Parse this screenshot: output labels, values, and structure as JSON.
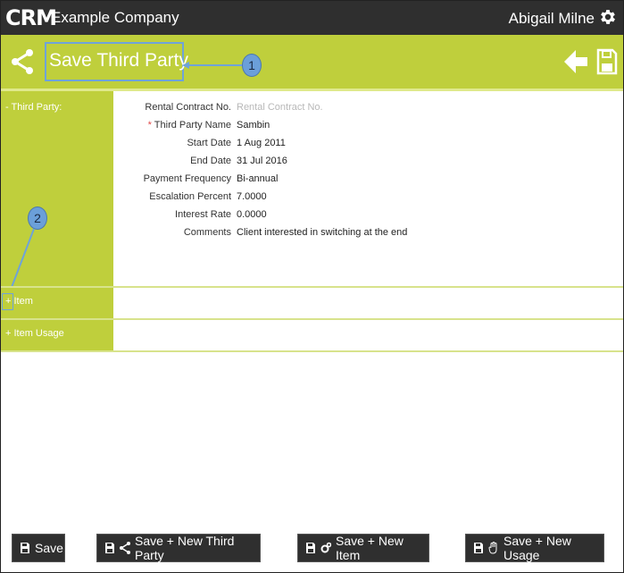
{
  "header": {
    "logo_text": "CRM",
    "company": "Example Company",
    "user": "Abigail Milne",
    "settings_icon": "gear-icon"
  },
  "titlebar": {
    "title": "Save Third Party",
    "icon": "share-icon",
    "back_icon": "arrow-left-icon",
    "save_icon": "floppy-disk-icon"
  },
  "callouts": {
    "one": "1",
    "two": "2"
  },
  "sections": {
    "third_party": {
      "label": "- Third Party:",
      "fields": [
        {
          "label": "Rental Contract No.",
          "value": "Rental Contract No.",
          "placeholder": true
        },
        {
          "label": "Third Party Name",
          "value": "Sambin",
          "required": true
        },
        {
          "label": "Start Date",
          "value": "1 Aug 2011"
        },
        {
          "label": "End Date",
          "value": "31 Jul 2016"
        },
        {
          "label": "Payment Frequency",
          "value": "Bi-annual"
        },
        {
          "label": "Escalation Percent",
          "value": "7.0000"
        },
        {
          "label": "Interest Rate",
          "value": "0.0000"
        },
        {
          "label": "Comments",
          "value": "Client interested in switching at the end"
        }
      ],
      "required_mark": "*"
    },
    "item": {
      "toggle": "+",
      "label": "Item"
    },
    "item_usage": {
      "label": "+ Item Usage"
    }
  },
  "buttons": {
    "save": "Save",
    "save_new_third_party": "Save + New Third Party",
    "save_new_item": "Save + New Item",
    "save_new_usage": "Save + New Usage"
  },
  "colors": {
    "accent": "#bfcf3c",
    "dark": "#2f2f2f",
    "callout": "#6b9fd9"
  }
}
